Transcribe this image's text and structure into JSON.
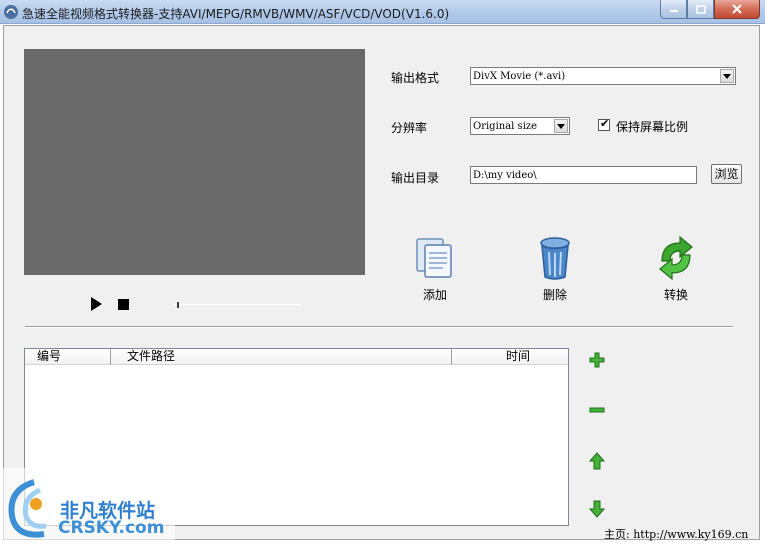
{
  "window": {
    "title": "急速全能视频格式转换器-支持AVI/MEPG/RMVB/WMV/ASF/VCD/VOD(V1.6.0)",
    "buttons": {
      "minimize": "—",
      "maximize": "□",
      "close": "✕"
    }
  },
  "player": {
    "play_icon": "play-icon",
    "stop_icon": "stop-icon",
    "seek_position": 0.0
  },
  "settings": {
    "format_label": "输出格式",
    "format_value": "DivX Movie (*.avi)",
    "resolution_label": "分辨率",
    "resolution_value": "Original size",
    "keep_ratio_label": "保持屏幕比例",
    "keep_ratio_checked": "✔",
    "output_dir_label": "输出目录",
    "output_dir_value": "D:\\my video\\",
    "browse_label": "浏览"
  },
  "toolbar": {
    "add_label": "添加",
    "delete_label": "删除",
    "convert_label": "转换"
  },
  "file_list": {
    "columns": [
      "编号",
      "文件路径",
      "时间"
    ],
    "rows": []
  },
  "side_buttons": [
    "add-icon",
    "remove-icon",
    "move-up-icon",
    "move-down-icon"
  ],
  "watermark": {
    "cn": "非凡软件站",
    "en": "CRSKY.com"
  },
  "footer": {
    "homepage": "主页: http://www.ky169.cn"
  },
  "colors": {
    "preview_bg": "#696969",
    "green_icon": "#3aa52f",
    "blue_icon": "#4b86c8"
  }
}
